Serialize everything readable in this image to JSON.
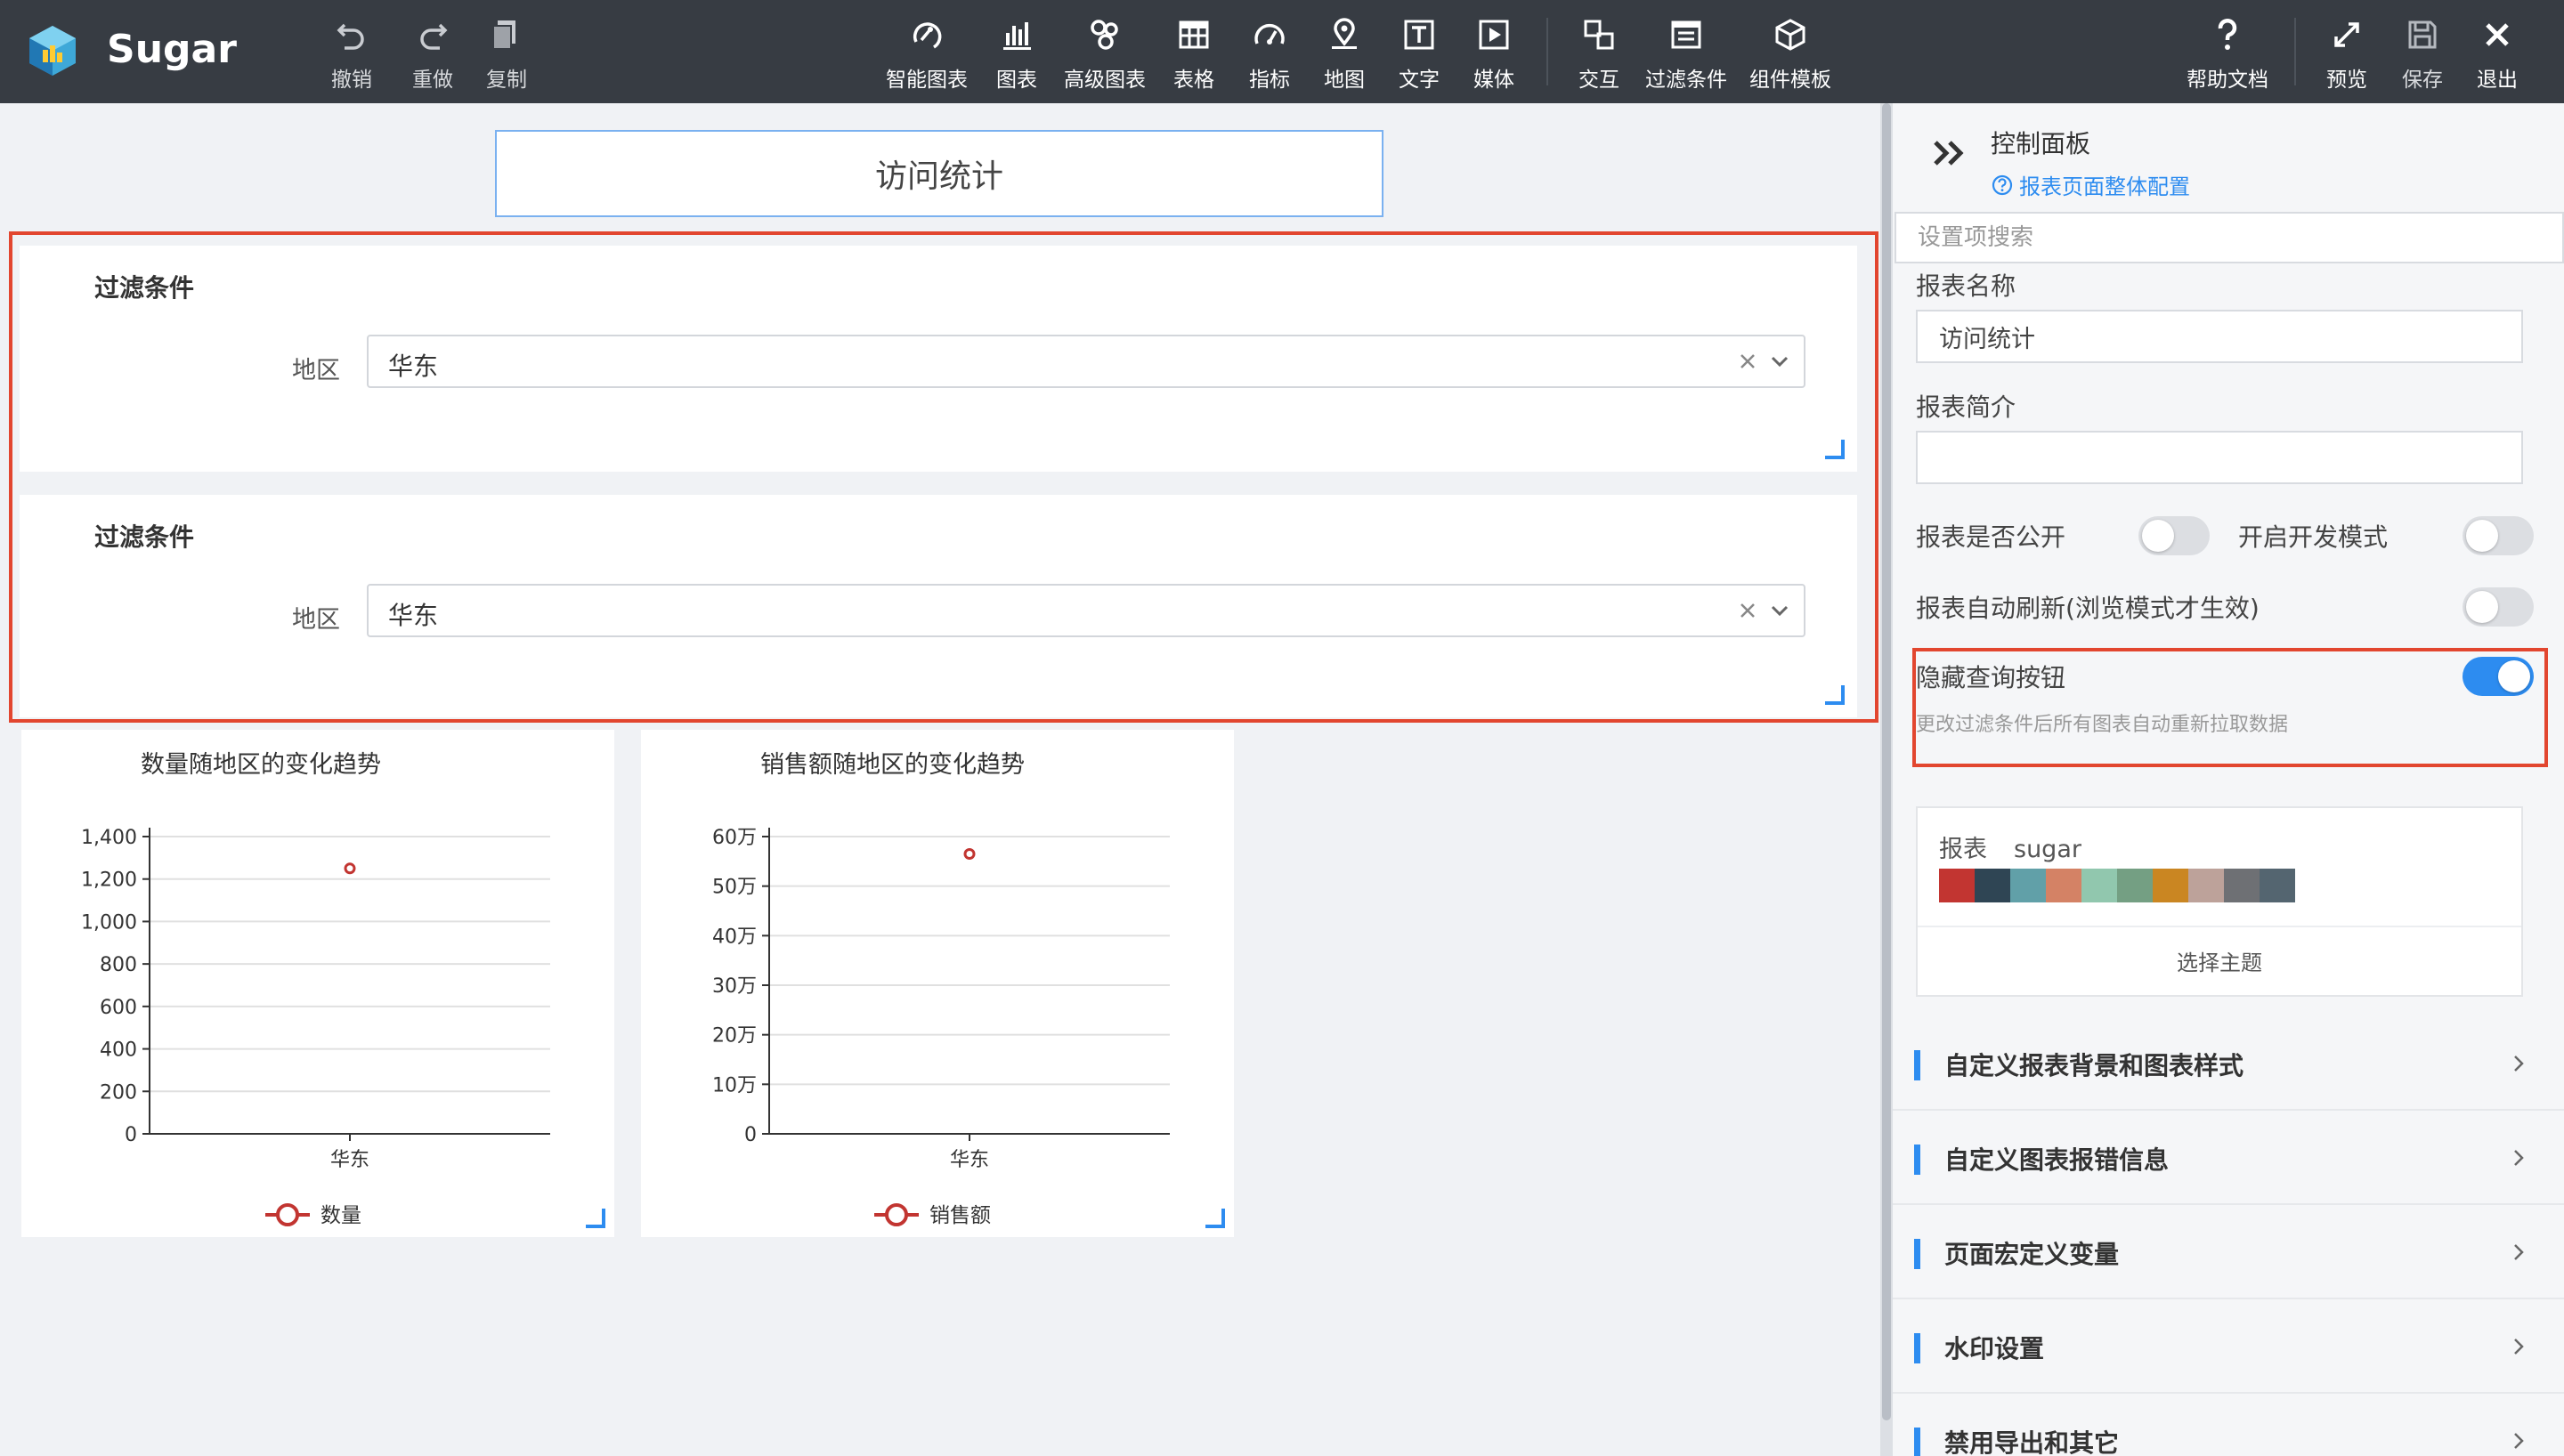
{
  "app": {
    "brand": "Sugar"
  },
  "toolbar": {
    "undo": "撤销",
    "redo": "重做",
    "copy": "复制",
    "smart_chart": "智能图表",
    "chart": "图表",
    "advanced_chart": "高级图表",
    "table": "表格",
    "metric": "指标",
    "map": "地图",
    "text": "文字",
    "media": "媒体",
    "interaction": "交互",
    "filter": "过滤条件",
    "component_template": "组件模板",
    "help": "帮助文档",
    "preview": "预览",
    "save": "保存",
    "exit": "退出"
  },
  "canvas": {
    "report_title": "访问统计",
    "filters": [
      {
        "title": "过滤条件",
        "label": "地区",
        "value": "华东"
      },
      {
        "title": "过滤条件",
        "label": "地区",
        "value": "华东"
      }
    ]
  },
  "chart_data": [
    {
      "type": "scatter",
      "title": "数量随地区的变化趋势",
      "categories": [
        "华东"
      ],
      "series": [
        {
          "name": "数量",
          "values": [
            1250
          ]
        }
      ],
      "ylim": [
        0,
        1400
      ],
      "yticks": [
        "0",
        "200",
        "400",
        "600",
        "800",
        "1,000",
        "1,200",
        "1,400"
      ],
      "grid": true,
      "legend": "bottom",
      "color": "#c23531"
    },
    {
      "type": "scatter",
      "title": "销售额随地区的变化趋势",
      "categories": [
        "华东"
      ],
      "series": [
        {
          "name": "销售额",
          "values": [
            565000
          ]
        }
      ],
      "ylim": [
        0,
        600000
      ],
      "yticks": [
        "0",
        "10万",
        "20万",
        "30万",
        "40万",
        "50万",
        "60万"
      ],
      "grid": true,
      "legend": "bottom",
      "color": "#c23531"
    }
  ],
  "panel": {
    "title": "控制面板",
    "config_link": "报表页面整体配置",
    "search_placeholder": "设置项搜索",
    "report_name_label": "报表名称",
    "report_name_value": "访问统计",
    "report_desc_label": "报表简介",
    "report_desc_value": "",
    "public_label": "报表是否公开",
    "public_on": false,
    "dev_mode_label": "开启开发模式",
    "dev_mode_on": false,
    "auto_refresh_label": "报表自动刷新(浏览模式才生效)",
    "auto_refresh_on": false,
    "hide_query_label": "隐藏查询按钮",
    "hide_query_on": true,
    "hide_query_hint": "更改过滤条件后所有图表自动重新拉取数据",
    "theme": {
      "label": "报表",
      "name": "sugar",
      "colors": [
        "#c23531",
        "#2f4554",
        "#61a0a8",
        "#d48265",
        "#91c7ae",
        "#749f83",
        "#ca8622",
        "#bda29a",
        "#6e7074",
        "#546570"
      ],
      "select_button": "选择主题"
    },
    "sections": [
      "自定义报表背景和图表样式",
      "自定义图表报错信息",
      "页面宏定义变量",
      "水印设置",
      "禁用导出和其它"
    ],
    "accent_color": "#2d8cf0"
  }
}
